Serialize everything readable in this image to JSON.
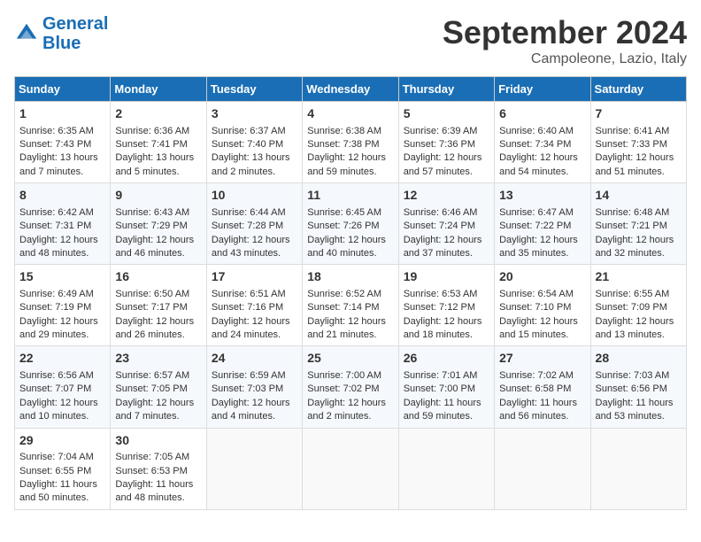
{
  "header": {
    "logo_line1": "General",
    "logo_line2": "Blue",
    "month": "September 2024",
    "location": "Campoleone, Lazio, Italy"
  },
  "columns": [
    "Sunday",
    "Monday",
    "Tuesday",
    "Wednesday",
    "Thursday",
    "Friday",
    "Saturday"
  ],
  "weeks": [
    [
      {
        "day": "1",
        "lines": [
          "Sunrise: 6:35 AM",
          "Sunset: 7:43 PM",
          "Daylight: 13 hours",
          "and 7 minutes."
        ]
      },
      {
        "day": "2",
        "lines": [
          "Sunrise: 6:36 AM",
          "Sunset: 7:41 PM",
          "Daylight: 13 hours",
          "and 5 minutes."
        ]
      },
      {
        "day": "3",
        "lines": [
          "Sunrise: 6:37 AM",
          "Sunset: 7:40 PM",
          "Daylight: 13 hours",
          "and 2 minutes."
        ]
      },
      {
        "day": "4",
        "lines": [
          "Sunrise: 6:38 AM",
          "Sunset: 7:38 PM",
          "Daylight: 12 hours",
          "and 59 minutes."
        ]
      },
      {
        "day": "5",
        "lines": [
          "Sunrise: 6:39 AM",
          "Sunset: 7:36 PM",
          "Daylight: 12 hours",
          "and 57 minutes."
        ]
      },
      {
        "day": "6",
        "lines": [
          "Sunrise: 6:40 AM",
          "Sunset: 7:34 PM",
          "Daylight: 12 hours",
          "and 54 minutes."
        ]
      },
      {
        "day": "7",
        "lines": [
          "Sunrise: 6:41 AM",
          "Sunset: 7:33 PM",
          "Daylight: 12 hours",
          "and 51 minutes."
        ]
      }
    ],
    [
      {
        "day": "8",
        "lines": [
          "Sunrise: 6:42 AM",
          "Sunset: 7:31 PM",
          "Daylight: 12 hours",
          "and 48 minutes."
        ]
      },
      {
        "day": "9",
        "lines": [
          "Sunrise: 6:43 AM",
          "Sunset: 7:29 PM",
          "Daylight: 12 hours",
          "and 46 minutes."
        ]
      },
      {
        "day": "10",
        "lines": [
          "Sunrise: 6:44 AM",
          "Sunset: 7:28 PM",
          "Daylight: 12 hours",
          "and 43 minutes."
        ]
      },
      {
        "day": "11",
        "lines": [
          "Sunrise: 6:45 AM",
          "Sunset: 7:26 PM",
          "Daylight: 12 hours",
          "and 40 minutes."
        ]
      },
      {
        "day": "12",
        "lines": [
          "Sunrise: 6:46 AM",
          "Sunset: 7:24 PM",
          "Daylight: 12 hours",
          "and 37 minutes."
        ]
      },
      {
        "day": "13",
        "lines": [
          "Sunrise: 6:47 AM",
          "Sunset: 7:22 PM",
          "Daylight: 12 hours",
          "and 35 minutes."
        ]
      },
      {
        "day": "14",
        "lines": [
          "Sunrise: 6:48 AM",
          "Sunset: 7:21 PM",
          "Daylight: 12 hours",
          "and 32 minutes."
        ]
      }
    ],
    [
      {
        "day": "15",
        "lines": [
          "Sunrise: 6:49 AM",
          "Sunset: 7:19 PM",
          "Daylight: 12 hours",
          "and 29 minutes."
        ]
      },
      {
        "day": "16",
        "lines": [
          "Sunrise: 6:50 AM",
          "Sunset: 7:17 PM",
          "Daylight: 12 hours",
          "and 26 minutes."
        ]
      },
      {
        "day": "17",
        "lines": [
          "Sunrise: 6:51 AM",
          "Sunset: 7:16 PM",
          "Daylight: 12 hours",
          "and 24 minutes."
        ]
      },
      {
        "day": "18",
        "lines": [
          "Sunrise: 6:52 AM",
          "Sunset: 7:14 PM",
          "Daylight: 12 hours",
          "and 21 minutes."
        ]
      },
      {
        "day": "19",
        "lines": [
          "Sunrise: 6:53 AM",
          "Sunset: 7:12 PM",
          "Daylight: 12 hours",
          "and 18 minutes."
        ]
      },
      {
        "day": "20",
        "lines": [
          "Sunrise: 6:54 AM",
          "Sunset: 7:10 PM",
          "Daylight: 12 hours",
          "and 15 minutes."
        ]
      },
      {
        "day": "21",
        "lines": [
          "Sunrise: 6:55 AM",
          "Sunset: 7:09 PM",
          "Daylight: 12 hours",
          "and 13 minutes."
        ]
      }
    ],
    [
      {
        "day": "22",
        "lines": [
          "Sunrise: 6:56 AM",
          "Sunset: 7:07 PM",
          "Daylight: 12 hours",
          "and 10 minutes."
        ]
      },
      {
        "day": "23",
        "lines": [
          "Sunrise: 6:57 AM",
          "Sunset: 7:05 PM",
          "Daylight: 12 hours",
          "and 7 minutes."
        ]
      },
      {
        "day": "24",
        "lines": [
          "Sunrise: 6:59 AM",
          "Sunset: 7:03 PM",
          "Daylight: 12 hours",
          "and 4 minutes."
        ]
      },
      {
        "day": "25",
        "lines": [
          "Sunrise: 7:00 AM",
          "Sunset: 7:02 PM",
          "Daylight: 12 hours",
          "and 2 minutes."
        ]
      },
      {
        "day": "26",
        "lines": [
          "Sunrise: 7:01 AM",
          "Sunset: 7:00 PM",
          "Daylight: 11 hours",
          "and 59 minutes."
        ]
      },
      {
        "day": "27",
        "lines": [
          "Sunrise: 7:02 AM",
          "Sunset: 6:58 PM",
          "Daylight: 11 hours",
          "and 56 minutes."
        ]
      },
      {
        "day": "28",
        "lines": [
          "Sunrise: 7:03 AM",
          "Sunset: 6:56 PM",
          "Daylight: 11 hours",
          "and 53 minutes."
        ]
      }
    ],
    [
      {
        "day": "29",
        "lines": [
          "Sunrise: 7:04 AM",
          "Sunset: 6:55 PM",
          "Daylight: 11 hours",
          "and 50 minutes."
        ]
      },
      {
        "day": "30",
        "lines": [
          "Sunrise: 7:05 AM",
          "Sunset: 6:53 PM",
          "Daylight: 11 hours",
          "and 48 minutes."
        ]
      },
      {
        "day": "",
        "lines": []
      },
      {
        "day": "",
        "lines": []
      },
      {
        "day": "",
        "lines": []
      },
      {
        "day": "",
        "lines": []
      },
      {
        "day": "",
        "lines": []
      }
    ]
  ]
}
